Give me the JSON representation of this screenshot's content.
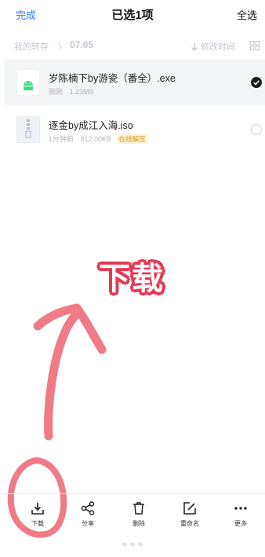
{
  "header": {
    "done_label": "完成",
    "title": "已选1项",
    "select_all_label": "全选"
  },
  "breadcrumb": {
    "root": "我的转存",
    "separator": "〉",
    "current": "07.05"
  },
  "sort": {
    "label": "修改时间",
    "icon": "arrow-down-icon"
  },
  "view_toggle": {
    "icon": "grid-view-icon"
  },
  "files": [
    {
      "name": "岁陈楠下by游瓷（番全）.exe",
      "time": "刚刚",
      "size": "1.23MB",
      "badge": "",
      "selected": true,
      "icon": "android-file-icon"
    },
    {
      "name": "逐金by成江入海.iso",
      "time": "1分钟前",
      "size": "912.00KB",
      "badge": "在线解压",
      "selected": false,
      "icon": "zip-file-icon"
    }
  ],
  "annotation": {
    "text": "下载",
    "color": "#f07a86"
  },
  "toolbar": {
    "items": [
      {
        "label": "下载",
        "icon": "download-icon"
      },
      {
        "label": "分享",
        "icon": "share-icon"
      },
      {
        "label": "删除",
        "icon": "trash-icon"
      },
      {
        "label": "重命名",
        "icon": "rename-icon"
      },
      {
        "label": "更多",
        "icon": "more-icon"
      }
    ]
  },
  "colors": {
    "accent": "#2f7cf6",
    "badge_bg": "#fdf2d8",
    "badge_text": "#d79a1a",
    "selected_row": "#f4f5f7"
  }
}
